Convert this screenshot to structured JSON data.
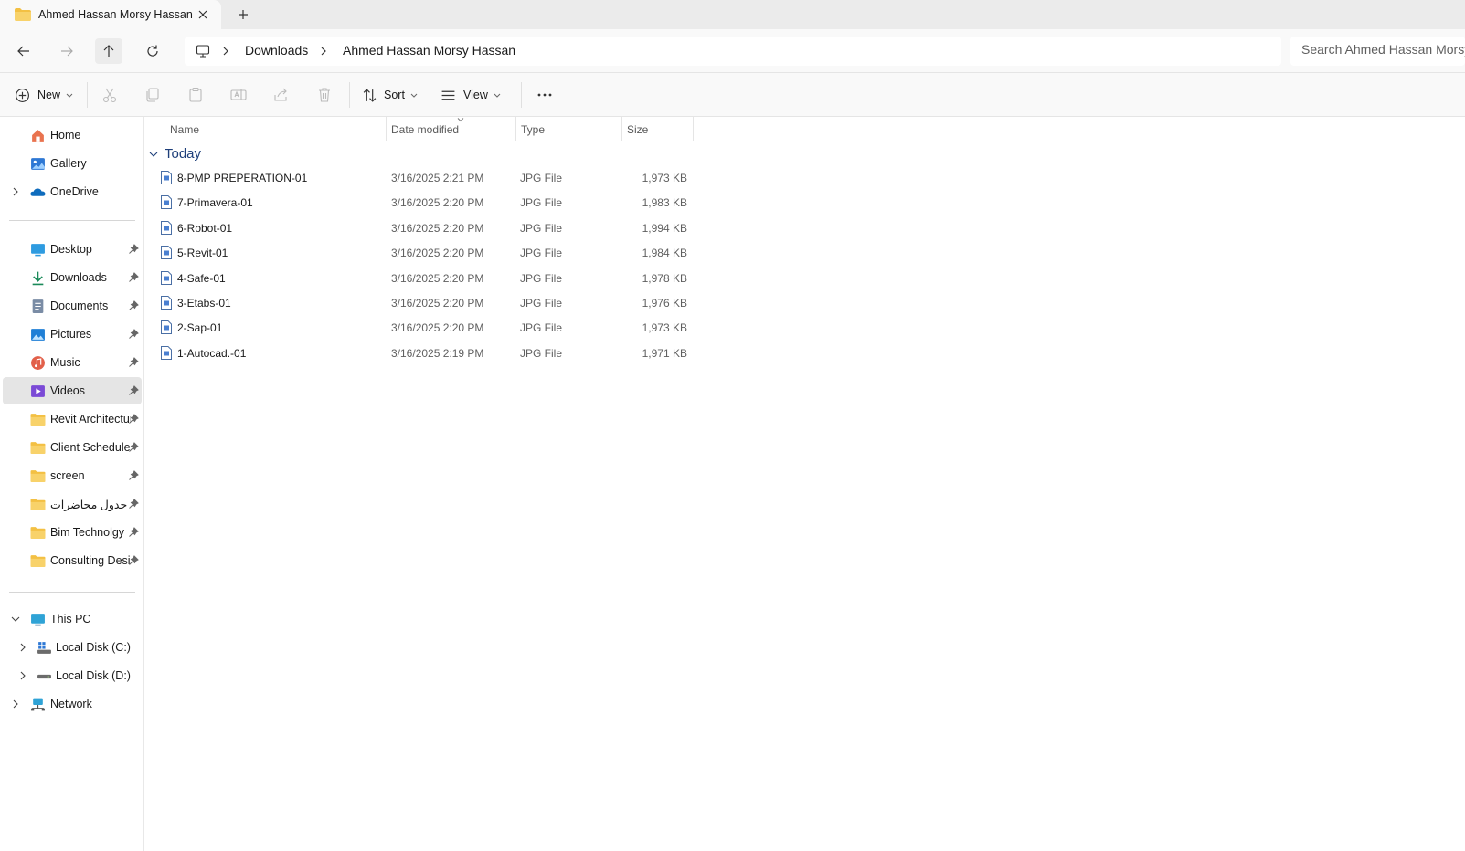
{
  "tab": {
    "title": "Ahmed Hassan Morsy Hassan"
  },
  "breadcrumb": [
    "Downloads",
    "Ahmed Hassan Morsy Hassan"
  ],
  "search": {
    "placeholder": "Search Ahmed Hassan Morsy Hassan"
  },
  "commands": {
    "new_label": "New",
    "sort_label": "Sort",
    "view_label": "View"
  },
  "sidebar": {
    "quick": [
      {
        "label": "Home",
        "icon": "home-icon"
      },
      {
        "label": "Gallery",
        "icon": "gallery-icon"
      },
      {
        "label": "OneDrive",
        "icon": "cloud-icon"
      }
    ],
    "pinned": [
      {
        "label": "Desktop",
        "icon": "desktop-icon"
      },
      {
        "label": "Downloads",
        "icon": "download-icon"
      },
      {
        "label": "Documents",
        "icon": "documents-icon"
      },
      {
        "label": "Pictures",
        "icon": "pictures-icon"
      },
      {
        "label": "Music",
        "icon": "music-icon"
      },
      {
        "label": "Videos",
        "icon": "videos-icon"
      },
      {
        "label": "Revit Architecture",
        "icon": "folder-icon"
      },
      {
        "label": "Client Schedules",
        "icon": "folder-icon"
      },
      {
        "label": "screen",
        "icon": "folder-icon"
      },
      {
        "label": "جدول محاضرات",
        "icon": "folder-icon"
      },
      {
        "label": "Bim Technolgy",
        "icon": "folder-icon"
      },
      {
        "label": "Consulting Design",
        "icon": "folder-icon"
      }
    ],
    "devices": [
      {
        "label": "This PC",
        "icon": "pc-icon"
      },
      {
        "label": "Local Disk (C:)",
        "icon": "disk-c-icon"
      },
      {
        "label": "Local Disk (D:)",
        "icon": "disk-d-icon"
      },
      {
        "label": "Network",
        "icon": "network-icon"
      }
    ]
  },
  "columns": {
    "name": "Name",
    "date": "Date modified",
    "type": "Type",
    "size": "Size"
  },
  "group": {
    "label": "Today"
  },
  "files": [
    {
      "name": "8-PMP PREPERATION-01",
      "date": "3/16/2025 2:21 PM",
      "type": "JPG File",
      "size": "1,973 KB"
    },
    {
      "name": "7-Primavera-01",
      "date": "3/16/2025 2:20 PM",
      "type": "JPG File",
      "size": "1,983 KB"
    },
    {
      "name": "6-Robot-01",
      "date": "3/16/2025 2:20 PM",
      "type": "JPG File",
      "size": "1,994 KB"
    },
    {
      "name": "5-Revit-01",
      "date": "3/16/2025 2:20 PM",
      "type": "JPG File",
      "size": "1,984 KB"
    },
    {
      "name": "4-Safe-01",
      "date": "3/16/2025 2:20 PM",
      "type": "JPG File",
      "size": "1,978 KB"
    },
    {
      "name": "3-Etabs-01",
      "date": "3/16/2025 2:20 PM",
      "type": "JPG File",
      "size": "1,976 KB"
    },
    {
      "name": "2-Sap-01",
      "date": "3/16/2025 2:20 PM",
      "type": "JPG File",
      "size": "1,973 KB"
    },
    {
      "name": "1-Autocad.-01",
      "date": "3/16/2025 2:19 PM",
      "type": "JPG File",
      "size": "1,971 KB"
    }
  ],
  "colors": {
    "accent": "#1e3f7a",
    "folder": "#f3c043",
    "selected": "#e5e5e5"
  }
}
